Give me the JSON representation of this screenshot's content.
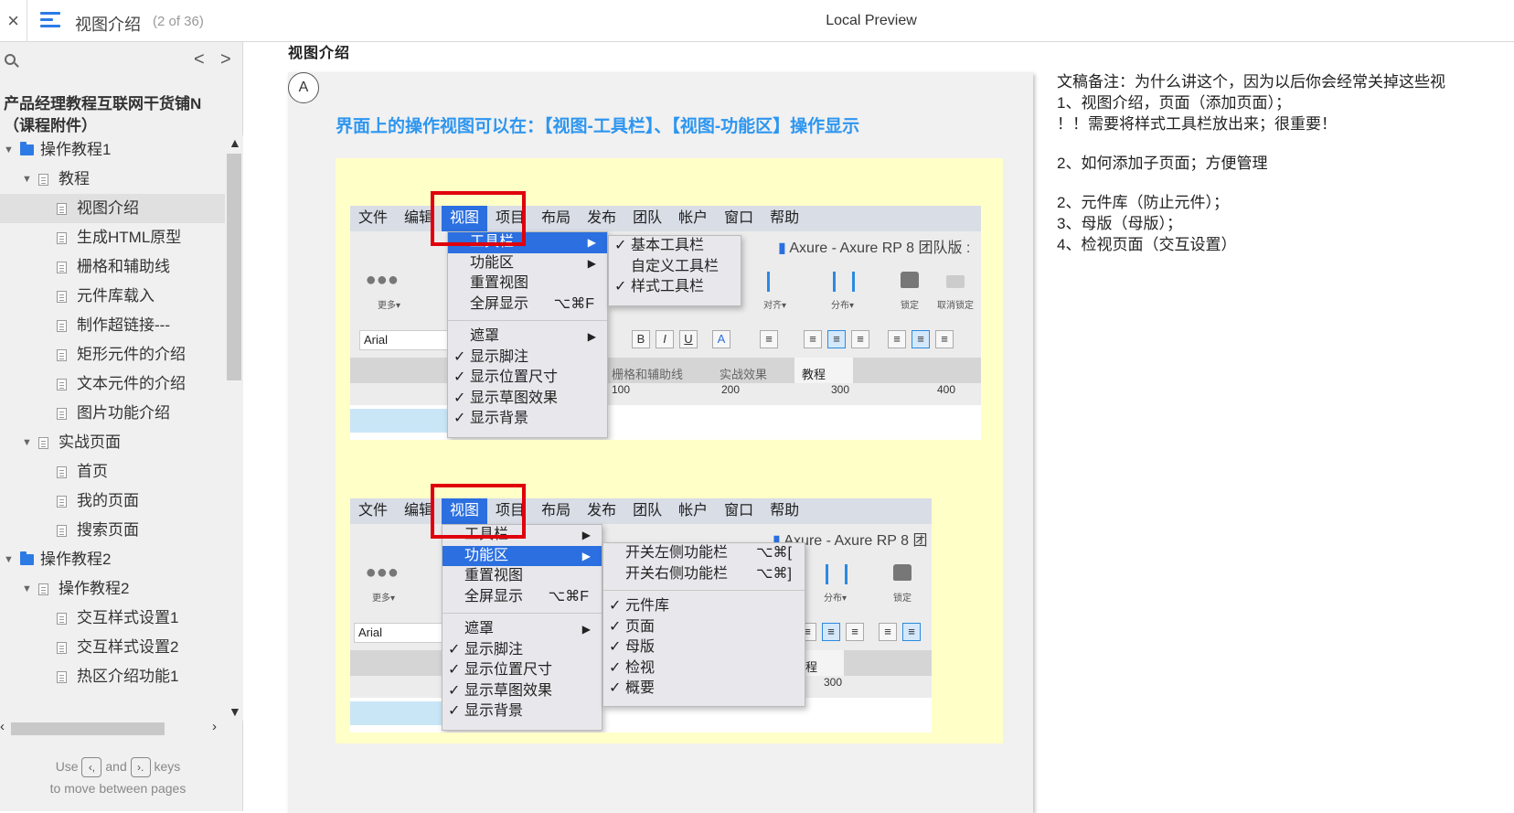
{
  "topbar": {
    "close": "×",
    "page_title": "视图介绍",
    "page_count": "(2 of 36)",
    "preview_title": "Local Preview"
  },
  "sidebar": {
    "nav_prev": "<",
    "nav_next": ">",
    "project_title": "产品经理教程互联网干货铺N（课程附件）",
    "tree": [
      {
        "label": "操作教程1",
        "type": "folder",
        "level": 0
      },
      {
        "label": "教程",
        "type": "page",
        "level": 1
      },
      {
        "label": "视图介绍",
        "type": "page",
        "level": 2,
        "selected": true
      },
      {
        "label": "生成HTML原型",
        "type": "page",
        "level": 2
      },
      {
        "label": "栅格和辅助线",
        "type": "page",
        "level": 2
      },
      {
        "label": "元件库载入",
        "type": "page",
        "level": 2
      },
      {
        "label": "制作超链接---",
        "type": "page",
        "level": 2
      },
      {
        "label": "矩形元件的介绍",
        "type": "page",
        "level": 2
      },
      {
        "label": "文本元件的介绍",
        "type": "page",
        "level": 2
      },
      {
        "label": "图片功能介绍",
        "type": "page",
        "level": 2
      },
      {
        "label": "实战页面",
        "type": "page",
        "level": 1
      },
      {
        "label": "首页",
        "type": "page",
        "level": 2
      },
      {
        "label": "我的页面",
        "type": "page",
        "level": 2
      },
      {
        "label": "搜索页面",
        "type": "page",
        "level": 2
      },
      {
        "label": "操作教程2",
        "type": "folder",
        "level": 0
      },
      {
        "label": "操作教程2",
        "type": "page",
        "level": 1
      },
      {
        "label": "交互样式设置1",
        "type": "page",
        "level": 2
      },
      {
        "label": "交互样式设置2",
        "type": "page",
        "level": 2
      },
      {
        "label": "热区介绍功能1",
        "type": "page",
        "level": 2
      }
    ],
    "hint_use": "Use",
    "hint_and": "and",
    "hint_keys": "keys",
    "hint_line2": "to move between pages",
    "key_prev": "‹,",
    "key_next": "›."
  },
  "content": {
    "cut_text": "视图介绍",
    "marker": "A",
    "headline": "界面上的操作视图可以在：【视图-工具栏】、【视图-功能区】操作显示",
    "notes": [
      "文稿备注：为什么讲这个，因为以后你会经常关掉这些视",
      "1、视图介绍，页面（添加页面）；",
      "！！需要将样式工具栏放出来；很重要！",
      "",
      "2、如何添加子页面；方便管理",
      "",
      "2、元件库（防止元件）；",
      "3、母版（母版）；",
      "4、检视页面（交互设置）"
    ]
  },
  "shot1": {
    "menubar": [
      "文件",
      "编辑",
      "视图",
      "项目",
      "布局",
      "发布",
      "团队",
      "帐户",
      "窗口",
      "帮助"
    ],
    "active_menu": "视图",
    "app_title": "Axure - Axure RP 8 团队版 :",
    "view_menu": [
      "工具栏",
      "功能区",
      "重置视图",
      "全屏显示",
      "遮罩",
      "显示脚注",
      "显示位置尺寸",
      "显示草图效果",
      "显示背景"
    ],
    "shortcut_fullscreen": "⌥⌘F",
    "toolbar_submenu": [
      "基本工具栏",
      "自定义工具栏",
      "样式工具栏"
    ],
    "font": "Arial",
    "more": "更多▾",
    "align": "对齐▾",
    "distribute": "分布▾",
    "lock": "锁定",
    "unlock": "取消锁定",
    "tabs": [
      "栅格和辅助线",
      "实战效果",
      "教程"
    ],
    "ruler": [
      "100",
      "200",
      "300",
      "400"
    ]
  },
  "shot2": {
    "menubar": [
      "文件",
      "编辑",
      "视图",
      "项目",
      "布局",
      "发布",
      "团队",
      "帐户",
      "窗口",
      "帮助"
    ],
    "active_menu": "视图",
    "app_title": "Axure - Axure RP 8 团",
    "view_menu": [
      "工具栏",
      "功能区",
      "重置视图",
      "全屏显示",
      "遮罩",
      "显示脚注",
      "显示位置尺寸",
      "显示草图效果",
      "显示背景"
    ],
    "shortcut_fullscreen": "⌥⌘F",
    "panel_submenu": [
      "开关左侧功能栏",
      "开关右侧功能栏",
      "元件库",
      "页面",
      "母版",
      "检视",
      "概要"
    ],
    "shortcut_left": "⌥⌘[",
    "shortcut_right": "⌥⌘]",
    "font": "Arial",
    "more": "更多▾",
    "distribute": "分布▾",
    "lock": "锁定",
    "tab": "程",
    "ruler": "300"
  }
}
